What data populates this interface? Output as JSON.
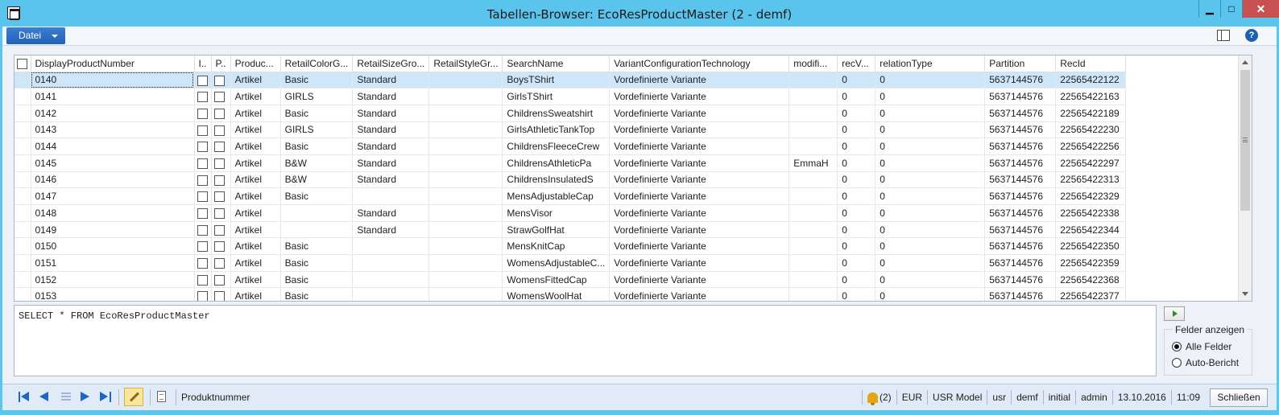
{
  "window": {
    "title": "Tabellen-Browser: EcoResProductMaster (2 - demf)",
    "minimize_glyph": "▁",
    "maximize_glyph": "□",
    "close_glyph": "✕"
  },
  "menubar": {
    "file_label": "Datei",
    "help_glyph": "?"
  },
  "grid": {
    "columns": [
      "DisplayProductNumber",
      "I..",
      "P..",
      "Produc...",
      "RetailColorG...",
      "RetailSizeGro...",
      "RetailStyleGr...",
      "SearchName",
      "VariantConfigurationTechnology",
      "modifi...",
      "recV...",
      "relationType",
      "Partition",
      "RecId"
    ],
    "rows": [
      {
        "num": "0140",
        "type": "Artikel",
        "color": "Basic",
        "size": "Standard",
        "style": "",
        "search": "BoysTShirt",
        "variant": "Vordefinierte Variante",
        "modified": "",
        "recv": "0",
        "relation": "0",
        "partition": "5637144576",
        "recid": "22565422122"
      },
      {
        "num": "0141",
        "type": "Artikel",
        "color": "GIRLS",
        "size": "Standard",
        "style": "",
        "search": "GirlsTShirt",
        "variant": "Vordefinierte Variante",
        "modified": "",
        "recv": "0",
        "relation": "0",
        "partition": "5637144576",
        "recid": "22565422163"
      },
      {
        "num": "0142",
        "type": "Artikel",
        "color": "Basic",
        "size": "Standard",
        "style": "",
        "search": "ChildrensSweatshirt",
        "variant": "Vordefinierte Variante",
        "modified": "",
        "recv": "0",
        "relation": "0",
        "partition": "5637144576",
        "recid": "22565422189"
      },
      {
        "num": "0143",
        "type": "Artikel",
        "color": "GIRLS",
        "size": "Standard",
        "style": "",
        "search": "GirlsAthleticTankTop",
        "variant": "Vordefinierte Variante",
        "modified": "",
        "recv": "0",
        "relation": "0",
        "partition": "5637144576",
        "recid": "22565422230"
      },
      {
        "num": "0144",
        "type": "Artikel",
        "color": "Basic",
        "size": "Standard",
        "style": "",
        "search": "ChildrensFleeceCrew",
        "variant": "Vordefinierte Variante",
        "modified": "",
        "recv": "0",
        "relation": "0",
        "partition": "5637144576",
        "recid": "22565422256"
      },
      {
        "num": "0145",
        "type": "Artikel",
        "color": "B&W",
        "size": "Standard",
        "style": "",
        "search": "ChildrensAthleticPa",
        "variant": "Vordefinierte Variante",
        "modified": "EmmaH",
        "recv": "0",
        "relation": "0",
        "partition": "5637144576",
        "recid": "22565422297"
      },
      {
        "num": "0146",
        "type": "Artikel",
        "color": "B&W",
        "size": "Standard",
        "style": "",
        "search": "ChildrensInsulatedS",
        "variant": "Vordefinierte Variante",
        "modified": "",
        "recv": "0",
        "relation": "0",
        "partition": "5637144576",
        "recid": "22565422313"
      },
      {
        "num": "0147",
        "type": "Artikel",
        "color": "Basic",
        "size": "",
        "style": "",
        "search": "MensAdjustableCap",
        "variant": "Vordefinierte Variante",
        "modified": "",
        "recv": "0",
        "relation": "0",
        "partition": "5637144576",
        "recid": "22565422329"
      },
      {
        "num": "0148",
        "type": "Artikel",
        "color": "",
        "size": "Standard",
        "style": "",
        "search": "MensVisor",
        "variant": "Vordefinierte Variante",
        "modified": "",
        "recv": "0",
        "relation": "0",
        "partition": "5637144576",
        "recid": "22565422338"
      },
      {
        "num": "0149",
        "type": "Artikel",
        "color": "",
        "size": "Standard",
        "style": "",
        "search": "StrawGolfHat",
        "variant": "Vordefinierte Variante",
        "modified": "",
        "recv": "0",
        "relation": "0",
        "partition": "5637144576",
        "recid": "22565422344"
      },
      {
        "num": "0150",
        "type": "Artikel",
        "color": "Basic",
        "size": "",
        "style": "",
        "search": "MensKnitCap",
        "variant": "Vordefinierte Variante",
        "modified": "",
        "recv": "0",
        "relation": "0",
        "partition": "5637144576",
        "recid": "22565422350"
      },
      {
        "num": "0151",
        "type": "Artikel",
        "color": "Basic",
        "size": "",
        "style": "",
        "search": "WomensAdjustableC...",
        "variant": "Vordefinierte Variante",
        "modified": "",
        "recv": "0",
        "relation": "0",
        "partition": "5637144576",
        "recid": "22565422359"
      },
      {
        "num": "0152",
        "type": "Artikel",
        "color": "Basic",
        "size": "",
        "style": "",
        "search": "WomensFittedCap",
        "variant": "Vordefinierte Variante",
        "modified": "",
        "recv": "0",
        "relation": "0",
        "partition": "5637144576",
        "recid": "22565422368"
      },
      {
        "num": "0153",
        "type": "Artikel",
        "color": "Basic",
        "size": "",
        "style": "",
        "search": "WomensWoolHat",
        "variant": "Vordefinierte Variante",
        "modified": "",
        "recv": "0",
        "relation": "0",
        "partition": "5637144576",
        "recid": "22565422377"
      }
    ],
    "selected_row_index": 0
  },
  "query": {
    "text": "SELECT * FROM EcoResProductMaster"
  },
  "fields_panel": {
    "title": "Felder anzeigen",
    "options": [
      "Alle Felder",
      "Auto-Bericht"
    ],
    "selected": "Alle Felder"
  },
  "statusbar": {
    "field_label": "Produktnummer",
    "notifications": "(2)",
    "currency": "EUR",
    "model": "USR Model",
    "layer": "usr",
    "company": "demf",
    "partition": "initial",
    "user": "admin",
    "date": "13.10.2016",
    "time": "11:09",
    "close_label": "Schließen"
  },
  "colors": {
    "title_bar": "#5bc4ec",
    "file_button": "#2a6cc4",
    "selected_row": "#cfe6f8",
    "close_window": "#c75050"
  },
  "icons": [
    "app-icon",
    "minimize-icon",
    "maximize-icon",
    "close-icon",
    "layout-icon",
    "help-icon",
    "run-query-icon",
    "first-record-icon",
    "previous-record-icon",
    "record-list-icon",
    "next-record-icon",
    "last-record-icon",
    "edit-mode-icon",
    "document-icon",
    "bell-icon"
  ]
}
